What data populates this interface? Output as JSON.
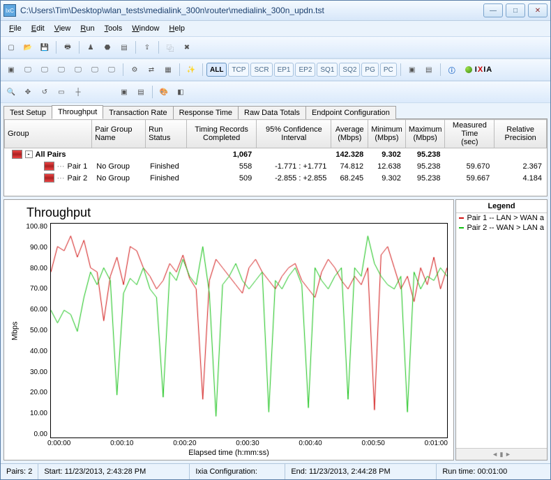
{
  "window": {
    "title": "C:\\Users\\Tim\\Desktop\\wlan_tests\\medialink_300n\\router\\medialink_300n_updn.tst",
    "app_icon_text": "IxC",
    "buttons": {
      "min": "—",
      "max": "□",
      "close": "✕"
    }
  },
  "menus": [
    "File",
    "Edit",
    "View",
    "Run",
    "Tools",
    "Window",
    "Help"
  ],
  "filter_buttons": [
    "ALL",
    "TCP",
    "SCR",
    "EP1",
    "EP2",
    "SQ1",
    "SQ2",
    "PG",
    "PC"
  ],
  "brand": "IXIA",
  "tabs": [
    "Test Setup",
    "Throughput",
    "Transaction Rate",
    "Response Time",
    "Raw Data Totals",
    "Endpoint Configuration"
  ],
  "active_tab_index": 1,
  "grid": {
    "columns": [
      "Group",
      "Pair Group Name",
      "Run Status",
      "Timing Records Completed",
      "95% Confidence Interval",
      "Average (Mbps)",
      "Minimum (Mbps)",
      "Maximum (Mbps)",
      "Measured Time (sec)",
      "Relative Precision"
    ],
    "rows": [
      {
        "group": "All Pairs",
        "pgname": "",
        "status": "",
        "timing": "1,067",
        "ci": "",
        "avg": "142.328",
        "min": "9.302",
        "max": "95.238",
        "mt": "",
        "rp": "",
        "bold": true,
        "root": true
      },
      {
        "group": "Pair 1",
        "pgname": "No Group",
        "status": "Finished",
        "timing": "558",
        "ci": "-1.771 : +1.771",
        "avg": "74.812",
        "min": "12.638",
        "max": "95.238",
        "mt": "59.670",
        "rp": "2.367"
      },
      {
        "group": "Pair 2",
        "pgname": "No Group",
        "status": "Finished",
        "timing": "509",
        "ci": "-2.855 : +2.855",
        "avg": "68.245",
        "min": "9.302",
        "max": "95.238",
        "mt": "59.667",
        "rp": "4.184"
      }
    ]
  },
  "chart_data": {
    "type": "line",
    "title": "Throughput",
    "xlabel": "Elapsed time (h:mm:ss)",
    "ylabel": "Mbps",
    "ylim": [
      0,
      100.8
    ],
    "yticks": [
      "100.80",
      "90.00",
      "80.00",
      "70.00",
      "60.00",
      "50.00",
      "40.00",
      "30.00",
      "20.00",
      "10.00",
      "0.00"
    ],
    "xticks": [
      "0:00:00",
      "0:00:10",
      "0:00:20",
      "0:00:30",
      "0:00:40",
      "0:00:50",
      "0:01:00"
    ],
    "x_seconds": [
      0,
      60
    ],
    "legend_title": "Legend",
    "series": [
      {
        "name": "Pair 1 -- LAN > WAN a",
        "color": "#d01010",
        "x": [
          0,
          1,
          2,
          3,
          4,
          5,
          6,
          7,
          8,
          9,
          10,
          11,
          12,
          13,
          14,
          15,
          16,
          17,
          18,
          19,
          20,
          21,
          22,
          23,
          24,
          25,
          26,
          27,
          28,
          29,
          30,
          31,
          32,
          33,
          34,
          35,
          36,
          37,
          38,
          39,
          40,
          41,
          42,
          43,
          44,
          45,
          46,
          47,
          48,
          49,
          50,
          51,
          52,
          53,
          54,
          55,
          56,
          57,
          58,
          59,
          60
        ],
        "y": [
          78,
          90,
          88,
          95,
          85,
          93,
          80,
          78,
          55,
          76,
          85,
          72,
          90,
          88,
          80,
          76,
          70,
          74,
          82,
          78,
          86,
          75,
          70,
          18,
          74,
          84,
          80,
          76,
          72,
          68,
          80,
          84,
          78,
          74,
          70,
          76,
          80,
          82,
          74,
          70,
          66,
          78,
          84,
          80,
          74,
          70,
          76,
          72,
          80,
          13,
          86,
          90,
          80,
          70,
          76,
          64,
          80,
          72,
          85,
          70,
          80
        ]
      },
      {
        "name": "Pair 2 -- WAN > LAN a",
        "color": "#10c010",
        "x": [
          0,
          1,
          2,
          3,
          4,
          5,
          6,
          7,
          8,
          9,
          10,
          11,
          12,
          13,
          14,
          15,
          16,
          17,
          18,
          19,
          20,
          21,
          22,
          23,
          24,
          25,
          26,
          27,
          28,
          29,
          30,
          31,
          32,
          33,
          34,
          35,
          36,
          37,
          38,
          39,
          40,
          41,
          42,
          43,
          44,
          45,
          46,
          47,
          48,
          49,
          50,
          51,
          52,
          53,
          54,
          55,
          56,
          57,
          58,
          59,
          60
        ],
        "y": [
          60,
          54,
          60,
          58,
          50,
          66,
          78,
          72,
          80,
          74,
          20,
          68,
          75,
          72,
          80,
          70,
          66,
          19,
          78,
          74,
          84,
          76,
          72,
          90,
          68,
          10,
          72,
          76,
          82,
          74,
          70,
          74,
          78,
          12,
          74,
          70,
          76,
          80,
          72,
          14,
          80,
          74,
          70,
          76,
          80,
          18,
          80,
          76,
          95,
          82,
          76,
          72,
          70,
          76,
          12,
          78,
          70,
          76,
          74,
          80,
          76
        ]
      }
    ]
  },
  "status": {
    "pairs_label": "Pairs:",
    "pairs_value": "2",
    "start_label": "Start:",
    "start_value": "11/23/2013, 2:43:28 PM",
    "config_label": "Ixia Configuration:",
    "end_label": "End:",
    "end_value": "11/23/2013, 2:44:28 PM",
    "run_label": "Run time:",
    "run_value": "00:01:00"
  }
}
